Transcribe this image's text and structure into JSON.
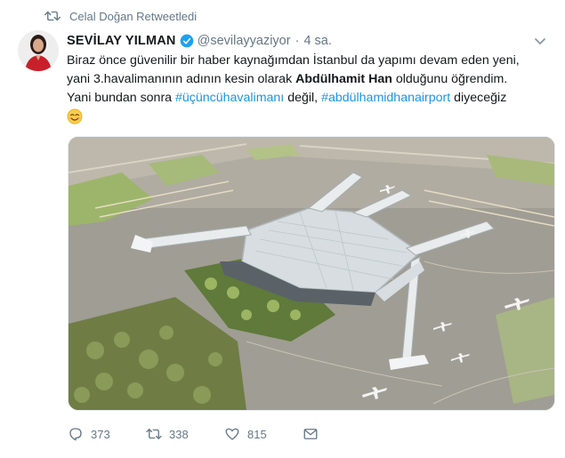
{
  "retweet_banner": {
    "text": "Celal Doğan Retweetledi",
    "icon": "retweet-icon"
  },
  "author": {
    "name": "SEVİLAY YILMAN",
    "handle": "@sevilayyaziyor",
    "separator": "·",
    "time": "4 sa.",
    "verified_icon": "verified-badge-icon",
    "avatar": "avatar"
  },
  "tweet": {
    "line1": "Biraz önce güvenilir bir haber kaynağımdan İstanbul da yapımı devam eden yeni,",
    "line2_pre": "yani 3.havalimanının adının kesin olarak ",
    "line2_bold": "Abdülhamit Han",
    "line2_post": " olduğunu öğrendim.",
    "line3_pre": "Yani bundan sonra ",
    "hashtag1": "#üçüncühavalimanı",
    "line3_mid": " değil, ",
    "hashtag2": "#abdülhamidhanairport",
    "line3_post": " diyeceğiz",
    "emoji": "smiling-face-emoji"
  },
  "actions": {
    "reply_count": "373",
    "retweet_count": "338",
    "like_count": "815",
    "icons": [
      "reply-icon",
      "retweet-icon",
      "like-icon",
      "message-icon"
    ]
  },
  "colors": {
    "link": "#1b95e0",
    "muted": "#657786",
    "verified": "#1da1f2",
    "text": "#14171a"
  }
}
